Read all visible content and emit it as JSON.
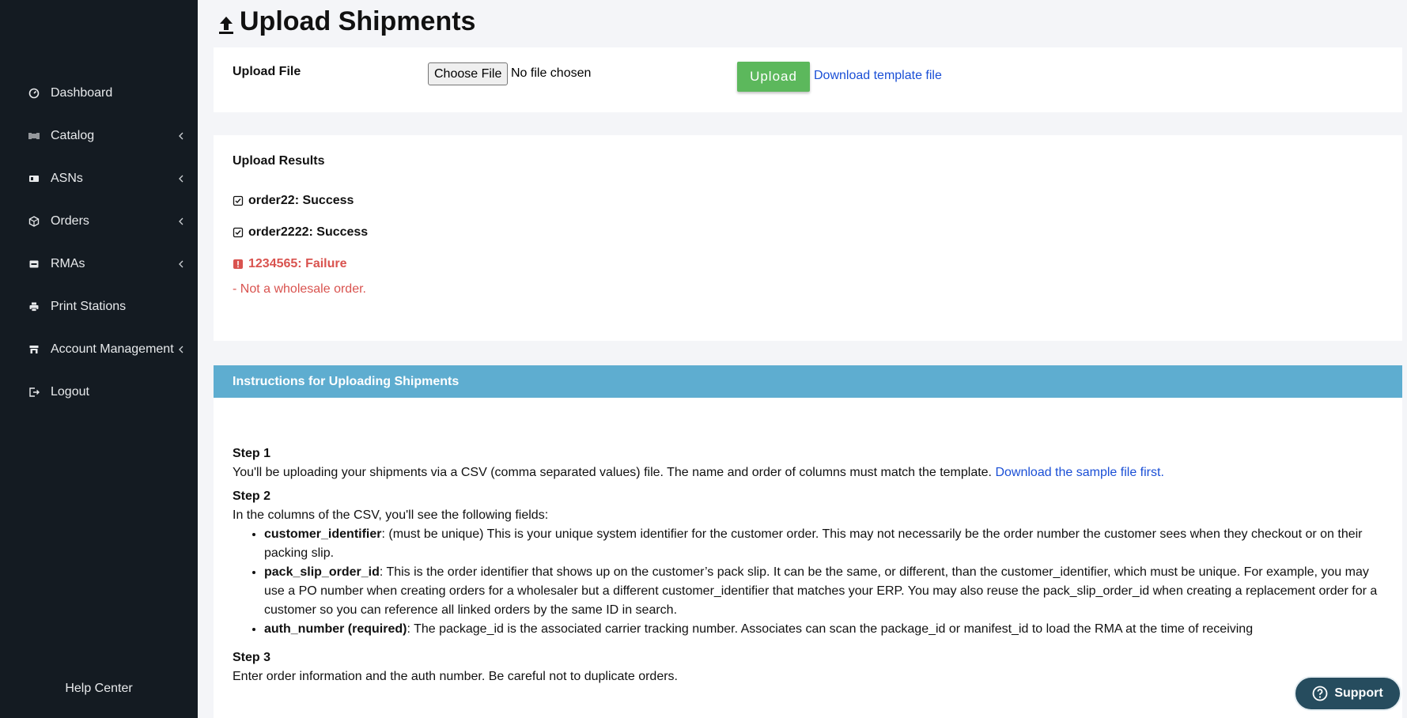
{
  "sidebar": {
    "items": [
      {
        "label": "Dashboard",
        "icon": "gauge-icon",
        "has_submenu": false
      },
      {
        "label": "Catalog",
        "icon": "barcode-icon",
        "has_submenu": true
      },
      {
        "label": "ASNs",
        "icon": "id-card-icon",
        "has_submenu": true
      },
      {
        "label": "Orders",
        "icon": "box-icon",
        "has_submenu": true
      },
      {
        "label": "RMAs",
        "icon": "inbox-icon",
        "has_submenu": true
      },
      {
        "label": "Print Stations",
        "icon": "printer-icon",
        "has_submenu": false
      },
      {
        "label": "Account Management",
        "icon": "store-icon",
        "has_submenu": true
      },
      {
        "label": "Logout",
        "icon": "sign-out-icon",
        "has_submenu": false
      }
    ],
    "help_label": "Help Center"
  },
  "page": {
    "title": "Upload Shipments"
  },
  "upload": {
    "label": "Upload File",
    "choose_file_label": "Choose File",
    "file_status": "No file chosen",
    "upload_button": "Upload",
    "template_link": "Download template file"
  },
  "results": {
    "title": "Upload Results",
    "rows": [
      {
        "text": "order22: Success",
        "status": "success"
      },
      {
        "text": "order2222: Success",
        "status": "success"
      },
      {
        "text": "1234565: Failure",
        "status": "failure"
      }
    ],
    "failure_note": "- Not a wholesale order."
  },
  "instructions": {
    "header": "Instructions for Uploading Shipments",
    "step1_title": "Step 1",
    "step1_text": "You'll be uploading your shipments via a CSV (comma separated values) file. The name and order of columns must match the template.",
    "step1_link": "Download the sample file first.",
    "step2_title": "Step 2",
    "step2_intro": "In the columns of the CSV, you'll see the following fields:",
    "fields": [
      {
        "name": "customer_identifier",
        "desc": ": (must be unique) This is your unique system identifier for the customer order. This may not necessarily be the order number the customer sees when they checkout or on their packing slip."
      },
      {
        "name": "pack_slip_order_id",
        "desc": ": This is the order identifier that shows up on the customer’s pack slip. It can be the same, or different, than the customer_identifier, which must be unique. For example, you may use a PO number when creating orders for a wholesaler but a different customer_identifier that matches your ERP. You may also reuse the pack_slip_order_id when creating a replacement order for a customer so you can reference all linked orders by the same ID in search."
      },
      {
        "name": "auth_number (required)",
        "desc": ": The package_id is the associated carrier tracking number. Associates can scan the package_id or manifest_id to load the RMA at the time of receiving"
      }
    ],
    "step3_title": "Step 3",
    "step3_text": "Enter order information and the auth number. Be careful not to duplicate orders."
  },
  "support": {
    "label": "Support"
  },
  "colors": {
    "sidebar_bg": "#141b22",
    "upload_button": "#5cb85c",
    "instructions_header": "#5eadd0",
    "failure": "#d9534f",
    "link": "#1a4fd6",
    "support_bg": "#264c5e"
  }
}
